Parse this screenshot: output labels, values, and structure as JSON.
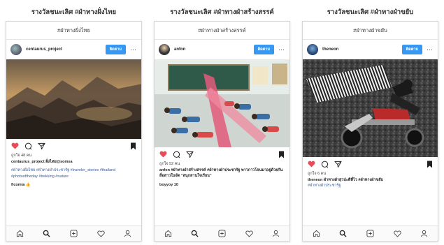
{
  "posts": [
    {
      "section_title": "รางวัลชนะเลิศ #ฝ่าทางฝั่งไทย",
      "header": "#ฝ่าทางฝั่งไทย",
      "username": "centaurus_project",
      "follow_label": "ติดตาม",
      "likes": "ถูกใจ 48 คน",
      "caption": "centaurus_project ฝั่งไทย@somsa",
      "hashtags": "#ฝ่าทางฝั่งไทย #ฝ่าทางฝ่าประชารัฐ #traveler_stories #thailand #photooftheday #trekking #nature",
      "comment": "ficomia 👍"
    },
    {
      "section_title": "รางวัลชนะเลิศ #ฝ่าทางฝ่าสร้างสรรค์",
      "header": "#ฝ่าทางฝ่าสร้างสรรค์",
      "username": "anfon",
      "follow_label": "ติดตาม",
      "likes": "ถูกใจ 52 คน",
      "caption": "anfon #ฝ่าทางฝ่าสร้างสรรค์ #ฝ่าทางฝ่าประชารัฐ พาวกาวโจนมาอยู่ด้วยกันสื่อสาวในจัด \"สนุกสานใจเรียน\"",
      "comment": "boyyoy 10"
    },
    {
      "section_title": "รางวัลชนะเลิศ #ฝ่าทางฝ่าขยับ",
      "header": "#ฝ่าทางฝ่าขยับ",
      "username": "theneon",
      "follow_label": "ติดตาม",
      "likes": "ถูกใจ 6 คน",
      "caption": "theneon ฝ่าทางฝ่าสุวปะดีที่ไว #ฝ่าทางฝ่าขยับ",
      "hashtags": "#ฝ่าทางฝ่าประชารัฐ"
    }
  ],
  "colors": {
    "follow_button": "#3897f0",
    "heart": "#ed4956",
    "hashtag": "#3b5998"
  },
  "icons": [
    "heart-icon",
    "comment-icon",
    "share-icon",
    "bookmark-icon",
    "home-icon",
    "search-icon",
    "add-icon",
    "activity-icon",
    "profile-icon",
    "more-icon"
  ]
}
